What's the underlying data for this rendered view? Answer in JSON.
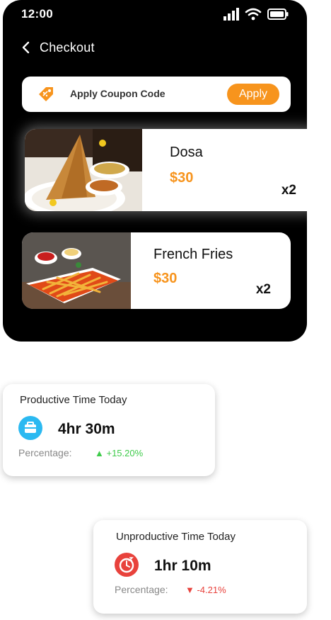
{
  "status_bar": {
    "time": "12:00"
  },
  "header": {
    "title": "Checkout"
  },
  "coupon": {
    "label": "Apply Coupon Code",
    "button": "Apply"
  },
  "cart_items": [
    {
      "name": "Dosa",
      "price": "$30",
      "quantity": "x2"
    },
    {
      "name": "French Fries",
      "price": "$30",
      "quantity": "x2"
    }
  ],
  "stats": [
    {
      "title": "Productive Time Today",
      "value": "4hr 30m",
      "percentage_label": "Percentage:",
      "percentage": "▲ +15.20%"
    },
    {
      "title": "Unproductive Time Today",
      "value": "1hr 10m",
      "percentage_label": "Percentage:",
      "percentage": "▼ -4.21%"
    }
  ],
  "colors": {
    "accent": "#f7941d",
    "positive": "#3ecb4a",
    "negative": "#e8423c",
    "productive_icon": "#2bb9f1"
  }
}
